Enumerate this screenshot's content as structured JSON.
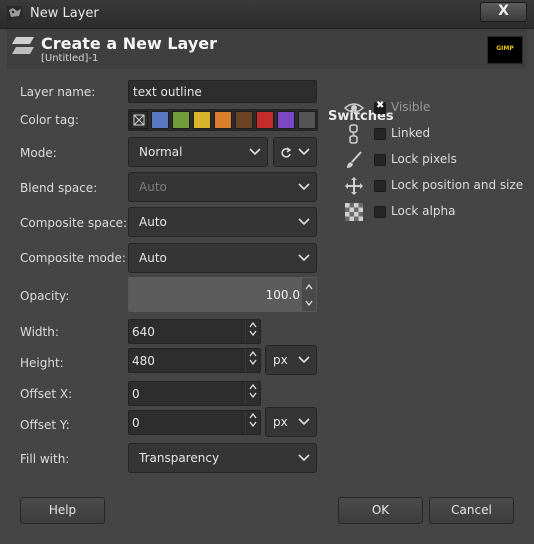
{
  "window": {
    "title": "New Layer",
    "close_label": "X"
  },
  "header": {
    "title": "Create a New Layer",
    "subtitle": "[Untitled]-1",
    "thumbnail_text": "GIMP"
  },
  "form": {
    "layer_name_label": "Layer name:",
    "layer_name_value": "text outline",
    "color_tag_label": "Color tag:",
    "color_tags": [
      "none",
      "#5b78c5",
      "#6f9d3a",
      "#d8b52d",
      "#d97e2b",
      "#6b4326",
      "#c62b2b",
      "#7c47c2",
      "#555555"
    ],
    "mode_label": "Mode:",
    "mode_value": "Normal",
    "blend_space_label": "Blend space:",
    "blend_space_value": "Auto",
    "composite_space_label": "Composite space:",
    "composite_space_value": "Auto",
    "composite_mode_label": "Composite mode:",
    "composite_mode_value": "Auto",
    "opacity_label": "Opacity:",
    "opacity_value": "100.0",
    "width_label": "Width:",
    "width_value": "640",
    "height_label": "Height:",
    "height_value": "480",
    "size_unit": "px",
    "offset_x_label": "Offset X:",
    "offset_x_value": "0",
    "offset_y_label": "Offset Y:",
    "offset_y_value": "0",
    "offset_unit": "px",
    "fill_label": "Fill with:",
    "fill_value": "Transparency"
  },
  "switches": {
    "title": "Switches",
    "visible_label": "Visible",
    "visible_checked": true,
    "linked_label": "Linked",
    "lock_pixels_label": "Lock pixels",
    "lock_position_label": "Lock position and size",
    "lock_alpha_label": "Lock alpha"
  },
  "buttons": {
    "help": "Help",
    "ok": "OK",
    "cancel": "Cancel"
  }
}
